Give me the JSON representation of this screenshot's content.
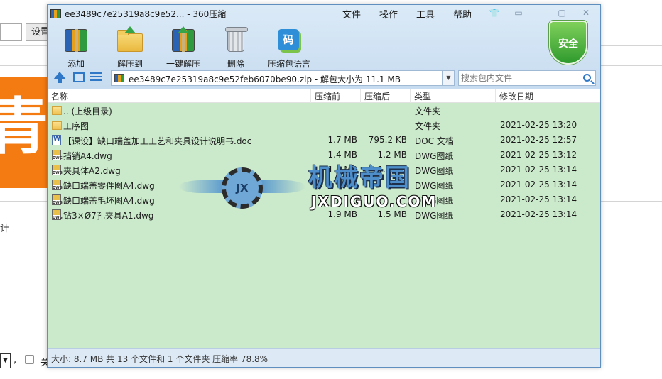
{
  "background": {
    "button_label": "设置",
    "banner_text": "青",
    "side_text": "计",
    "select_arrow": "▼",
    "comma": ",",
    "footer_char": "关"
  },
  "window": {
    "title": "ee3489c7e25319a8c9e52... - 360压缩",
    "menu": [
      "文件",
      "操作",
      "工具",
      "帮助"
    ],
    "controls": {
      "skin": "👕",
      "feedback": "▭",
      "minimize": "—",
      "maximize": "▢",
      "close": "✕"
    }
  },
  "toolbar": [
    {
      "label": "添加",
      "icon": "add-archive-icon"
    },
    {
      "label": "解压到",
      "icon": "extract-to-icon"
    },
    {
      "label": "一键解压",
      "icon": "one-click-extract-icon"
    },
    {
      "label": "删除",
      "icon": "trash-can-icon"
    },
    {
      "label": "压缩包语言",
      "icon": "code-language-icon",
      "glyph": "码"
    }
  ],
  "security_badge": "安全",
  "address": {
    "path": "ee3489c7e25319a8c9e52feb6070be90.zip - 解包大小为 11.1 MB",
    "v_symbol": "V",
    "dropdown": "▼"
  },
  "search": {
    "placeholder": "搜索包内文件"
  },
  "columns": [
    "名称",
    "压缩前",
    "压缩后",
    "类型",
    "修改日期"
  ],
  "files": [
    {
      "name": ".. (上级目录)",
      "before": "",
      "after": "",
      "type": "文件夹",
      "date": "",
      "icon": "folder"
    },
    {
      "name": "工序图",
      "before": "",
      "after": "",
      "type": "文件夹",
      "date": "2021-02-25 13:20",
      "icon": "folder"
    },
    {
      "name": "【课设】缺口端盖加工工艺和夹具设计说明书.doc",
      "before": "1.7 MB",
      "after": "795.2 KB",
      "type": "DOC 文档",
      "date": "2021-02-25 12:57",
      "icon": "doc"
    },
    {
      "name": "挡销A4.dwg",
      "before": "1.4 MB",
      "after": "1.2 MB",
      "type": "DWG图纸",
      "date": "2021-02-25 13:12",
      "icon": "dwg"
    },
    {
      "name": "夹具体A2.dwg",
      "before": "1.6 MB",
      "after": "1.2 MB",
      "type": "DWG图纸",
      "date": "2021-02-25 13:14",
      "icon": "dwg"
    },
    {
      "name": "缺口端盖零件图A4.dwg",
      "before": "",
      "after": "",
      "type": "DWG图纸",
      "date": "2021-02-25 13:14",
      "icon": "dwg"
    },
    {
      "name": "缺口端盖毛坯图A4.dwg",
      "before": "",
      "after": "",
      "type": "DWG图纸",
      "date": "2021-02-25 13:14",
      "icon": "dwg"
    },
    {
      "name": "钻3×Ø7孔夹具A1.dwg",
      "before": "1.9 MB",
      "after": "1.5 MB",
      "type": "DWG图纸",
      "date": "2021-02-25 13:14",
      "icon": "dwg"
    }
  ],
  "status": "大小: 8.7 MB 共 13 个文件和 1 个文件夹 压缩率 78.8%",
  "watermark": {
    "emblem": "JX",
    "cn": "机械帝国",
    "en": "JXDIGUO.COM"
  }
}
